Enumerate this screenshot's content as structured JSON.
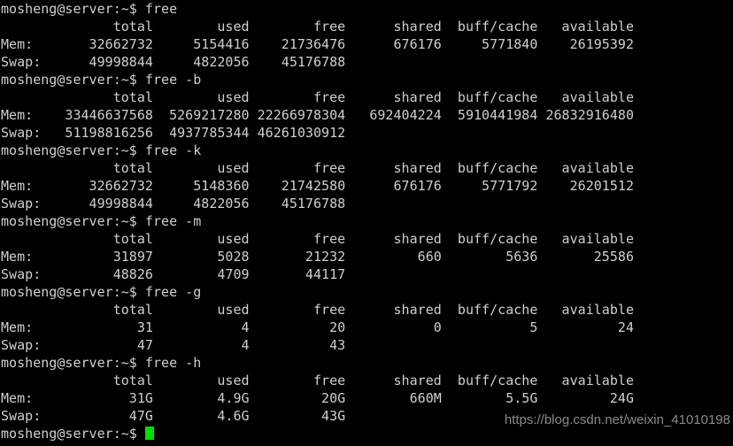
{
  "terminal": {
    "prompt": "mosheng@server:~$ ",
    "shell_user": "mosheng",
    "shell_host": "server",
    "shell_cwd": "~",
    "colors": {
      "background": "#000000",
      "foreground": "#cfcfcf",
      "cursor": "#00e000",
      "watermark": "#8a8a8a"
    },
    "columns": {
      "label_width": 6,
      "value_width": 12,
      "header_labels": [
        "total",
        "used",
        "free",
        "shared",
        "buff/cache",
        "available"
      ]
    },
    "blocks": [
      {
        "command": "free",
        "command_line": "mosheng@server:~$ free",
        "header": "              total        used        free      shared  buff/cache   available",
        "rows": [
          {
            "label": "Mem:",
            "line": "Mem:       32662732     5154416    21736476      676176     5771840    26195392",
            "total": "32662732",
            "used": "5154416",
            "free": "21736476",
            "shared": "676176",
            "buff_cache": "5771840",
            "available": "26195392"
          },
          {
            "label": "Swap:",
            "line": "Swap:      49998844     4822056    45176788",
            "total": "49998844",
            "used": "4822056",
            "free": "45176788",
            "shared": "",
            "buff_cache": "",
            "available": ""
          }
        ]
      },
      {
        "command": "free -b",
        "command_line": "mosheng@server:~$ free -b",
        "header": "              total        used        free      shared  buff/cache   available",
        "rows": [
          {
            "label": "Mem:",
            "line": "Mem:    33446637568  5269217280 22266978304   692404224  5910441984 26832916480",
            "total": "33446637568",
            "used": "5269217280",
            "free": "22266978304",
            "shared": "692404224",
            "buff_cache": "5910441984",
            "available": "26832916480"
          },
          {
            "label": "Swap:",
            "line": "Swap:   51198816256  4937785344 46261030912",
            "total": "51198816256",
            "used": "4937785344",
            "free": "46261030912",
            "shared": "",
            "buff_cache": "",
            "available": ""
          }
        ]
      },
      {
        "command": "free -k",
        "command_line": "mosheng@server:~$ free -k",
        "header": "              total        used        free      shared  buff/cache   available",
        "rows": [
          {
            "label": "Mem:",
            "line": "Mem:       32662732     5148360    21742580      676176     5771792    26201512",
            "total": "32662732",
            "used": "5148360",
            "free": "21742580",
            "shared": "676176",
            "buff_cache": "5771792",
            "available": "26201512"
          },
          {
            "label": "Swap:",
            "line": "Swap:      49998844     4822056    45176788",
            "total": "49998844",
            "used": "4822056",
            "free": "45176788",
            "shared": "",
            "buff_cache": "",
            "available": ""
          }
        ]
      },
      {
        "command": "free -m",
        "command_line": "mosheng@server:~$ free -m",
        "header": "              total        used        free      shared  buff/cache   available",
        "rows": [
          {
            "label": "Mem:",
            "line": "Mem:          31897        5028       21232         660        5636       25586",
            "total": "31897",
            "used": "5028",
            "free": "21232",
            "shared": "660",
            "buff_cache": "5636",
            "available": "25586"
          },
          {
            "label": "Swap:",
            "line": "Swap:         48826        4709       44117",
            "total": "48826",
            "used": "4709",
            "free": "44117",
            "shared": "",
            "buff_cache": "",
            "available": ""
          }
        ]
      },
      {
        "command": "free -g",
        "command_line": "mosheng@server:~$ free -g",
        "header": "              total        used        free      shared  buff/cache   available",
        "rows": [
          {
            "label": "Mem:",
            "line": "Mem:             31           4          20           0           5          24",
            "total": "31",
            "used": "4",
            "free": "20",
            "shared": "0",
            "buff_cache": "5",
            "available": "24"
          },
          {
            "label": "Swap:",
            "line": "Swap:            47           4          43",
            "total": "47",
            "used": "4",
            "free": "43",
            "shared": "",
            "buff_cache": "",
            "available": ""
          }
        ]
      },
      {
        "command": "free -h",
        "command_line": "mosheng@server:~$ free -h",
        "header": "              total        used        free      shared  buff/cache   available",
        "rows": [
          {
            "label": "Mem:",
            "line": "Mem:            31G        4.9G         20G        660M        5.5G         24G",
            "total": "31G",
            "used": "4.9G",
            "free": "20G",
            "shared": "660M",
            "buff_cache": "5.5G",
            "available": "24G"
          },
          {
            "label": "Swap:",
            "line": "Swap:           47G        4.6G         43G",
            "total": "47G",
            "used": "4.6G",
            "free": "43G",
            "shared": "",
            "buff_cache": "",
            "available": ""
          }
        ]
      }
    ],
    "final_prompt": "mosheng@server:~$ ",
    "watermark": "https://blog.csdn.net/weixin_41010198"
  }
}
